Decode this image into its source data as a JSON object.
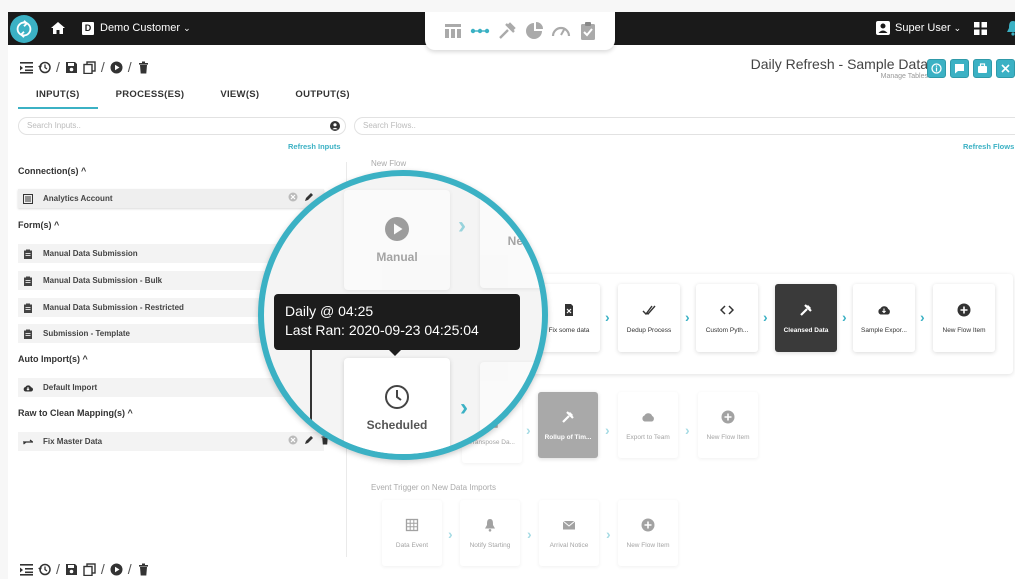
{
  "topbar": {
    "customer": "Demo Customer",
    "user": "Super User",
    "logo_icon": "sync-logo-icon",
    "mode_icons": [
      "table-icon",
      "flow-dots-icon",
      "tools-icon",
      "pie-chart-icon",
      "gauge-icon",
      "clipboard-check-icon"
    ]
  },
  "header": {
    "title": "Daily Refresh - Sample Data",
    "subtitle": "Manage Tables"
  },
  "tabs": [
    {
      "label": "INPUT(S)",
      "active": true
    },
    {
      "label": "PROCESS(ES)",
      "active": false
    },
    {
      "label": "VIEW(S)",
      "active": false
    },
    {
      "label": "OUTPUT(S)",
      "active": false
    }
  ],
  "search_inputs": {
    "placeholder": "Search Inputs..",
    "refresh": "Refresh Inputs"
  },
  "search_flows": {
    "placeholder": "Search Flows..",
    "refresh": "Refresh Flows"
  },
  "sections": {
    "connections": {
      "title": "Connection(s) ^",
      "items": [
        "Analytics Account"
      ]
    },
    "forms": {
      "title": "Form(s) ^",
      "items": [
        "Manual Data Submission",
        "Manual Data Submission - Bulk",
        "Manual Data Submission - Restricted",
        "Submission - Template"
      ]
    },
    "auto_imports": {
      "title": "Auto Import(s) ^",
      "items": [
        "Default Import"
      ]
    },
    "mappings": {
      "title": "Raw to Clean Mapping(s) ^",
      "items": [
        "Fix Master Data"
      ]
    }
  },
  "flows": {
    "new_flow": {
      "label": "New Flow",
      "nodes": [
        "Manual",
        "New"
      ]
    },
    "main": {
      "nodes": [
        "Fix some data",
        "Dedup Process",
        "Custom Pyth...",
        "Cleansed Data",
        "Sample Expor...",
        "New Flow Item"
      ]
    },
    "secondary": {
      "nodes": [
        "Transpose Da...",
        "Rollup of Tim...",
        "Export to Team",
        "New Flow Item"
      ]
    },
    "event": {
      "label": "Event Trigger on New Data Imports",
      "nodes": [
        "Data Event",
        "Notify Starting",
        "Arrival Notice",
        "New Flow Item"
      ]
    }
  },
  "magnifier": {
    "tooltip_line1": "Daily @ 04:25",
    "tooltip_line2": "Last Ran: 2020-09-23 04:25:04",
    "manual": "Manual",
    "new": "New",
    "scheduled": "Scheduled"
  },
  "colors": {
    "accent": "#3bb1c4",
    "topbar": "#1a1a1a",
    "dark_node": "#3a3a3a"
  }
}
